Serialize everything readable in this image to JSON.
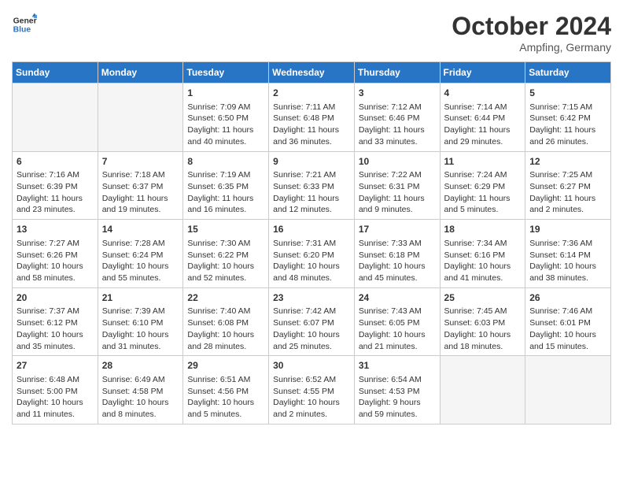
{
  "header": {
    "logo_line1": "General",
    "logo_line2": "Blue",
    "month": "October 2024",
    "location": "Ampfing, Germany"
  },
  "days_of_week": [
    "Sunday",
    "Monday",
    "Tuesday",
    "Wednesday",
    "Thursday",
    "Friday",
    "Saturday"
  ],
  "weeks": [
    [
      {
        "day": "",
        "info": ""
      },
      {
        "day": "",
        "info": ""
      },
      {
        "day": "1",
        "info": "Sunrise: 7:09 AM\nSunset: 6:50 PM\nDaylight: 11 hours and 40 minutes."
      },
      {
        "day": "2",
        "info": "Sunrise: 7:11 AM\nSunset: 6:48 PM\nDaylight: 11 hours and 36 minutes."
      },
      {
        "day": "3",
        "info": "Sunrise: 7:12 AM\nSunset: 6:46 PM\nDaylight: 11 hours and 33 minutes."
      },
      {
        "day": "4",
        "info": "Sunrise: 7:14 AM\nSunset: 6:44 PM\nDaylight: 11 hours and 29 minutes."
      },
      {
        "day": "5",
        "info": "Sunrise: 7:15 AM\nSunset: 6:42 PM\nDaylight: 11 hours and 26 minutes."
      }
    ],
    [
      {
        "day": "6",
        "info": "Sunrise: 7:16 AM\nSunset: 6:39 PM\nDaylight: 11 hours and 23 minutes."
      },
      {
        "day": "7",
        "info": "Sunrise: 7:18 AM\nSunset: 6:37 PM\nDaylight: 11 hours and 19 minutes."
      },
      {
        "day": "8",
        "info": "Sunrise: 7:19 AM\nSunset: 6:35 PM\nDaylight: 11 hours and 16 minutes."
      },
      {
        "day": "9",
        "info": "Sunrise: 7:21 AM\nSunset: 6:33 PM\nDaylight: 11 hours and 12 minutes."
      },
      {
        "day": "10",
        "info": "Sunrise: 7:22 AM\nSunset: 6:31 PM\nDaylight: 11 hours and 9 minutes."
      },
      {
        "day": "11",
        "info": "Sunrise: 7:24 AM\nSunset: 6:29 PM\nDaylight: 11 hours and 5 minutes."
      },
      {
        "day": "12",
        "info": "Sunrise: 7:25 AM\nSunset: 6:27 PM\nDaylight: 11 hours and 2 minutes."
      }
    ],
    [
      {
        "day": "13",
        "info": "Sunrise: 7:27 AM\nSunset: 6:26 PM\nDaylight: 10 hours and 58 minutes."
      },
      {
        "day": "14",
        "info": "Sunrise: 7:28 AM\nSunset: 6:24 PM\nDaylight: 10 hours and 55 minutes."
      },
      {
        "day": "15",
        "info": "Sunrise: 7:30 AM\nSunset: 6:22 PM\nDaylight: 10 hours and 52 minutes."
      },
      {
        "day": "16",
        "info": "Sunrise: 7:31 AM\nSunset: 6:20 PM\nDaylight: 10 hours and 48 minutes."
      },
      {
        "day": "17",
        "info": "Sunrise: 7:33 AM\nSunset: 6:18 PM\nDaylight: 10 hours and 45 minutes."
      },
      {
        "day": "18",
        "info": "Sunrise: 7:34 AM\nSunset: 6:16 PM\nDaylight: 10 hours and 41 minutes."
      },
      {
        "day": "19",
        "info": "Sunrise: 7:36 AM\nSunset: 6:14 PM\nDaylight: 10 hours and 38 minutes."
      }
    ],
    [
      {
        "day": "20",
        "info": "Sunrise: 7:37 AM\nSunset: 6:12 PM\nDaylight: 10 hours and 35 minutes."
      },
      {
        "day": "21",
        "info": "Sunrise: 7:39 AM\nSunset: 6:10 PM\nDaylight: 10 hours and 31 minutes."
      },
      {
        "day": "22",
        "info": "Sunrise: 7:40 AM\nSunset: 6:08 PM\nDaylight: 10 hours and 28 minutes."
      },
      {
        "day": "23",
        "info": "Sunrise: 7:42 AM\nSunset: 6:07 PM\nDaylight: 10 hours and 25 minutes."
      },
      {
        "day": "24",
        "info": "Sunrise: 7:43 AM\nSunset: 6:05 PM\nDaylight: 10 hours and 21 minutes."
      },
      {
        "day": "25",
        "info": "Sunrise: 7:45 AM\nSunset: 6:03 PM\nDaylight: 10 hours and 18 minutes."
      },
      {
        "day": "26",
        "info": "Sunrise: 7:46 AM\nSunset: 6:01 PM\nDaylight: 10 hours and 15 minutes."
      }
    ],
    [
      {
        "day": "27",
        "info": "Sunrise: 6:48 AM\nSunset: 5:00 PM\nDaylight: 10 hours and 11 minutes."
      },
      {
        "day": "28",
        "info": "Sunrise: 6:49 AM\nSunset: 4:58 PM\nDaylight: 10 hours and 8 minutes."
      },
      {
        "day": "29",
        "info": "Sunrise: 6:51 AM\nSunset: 4:56 PM\nDaylight: 10 hours and 5 minutes."
      },
      {
        "day": "30",
        "info": "Sunrise: 6:52 AM\nSunset: 4:55 PM\nDaylight: 10 hours and 2 minutes."
      },
      {
        "day": "31",
        "info": "Sunrise: 6:54 AM\nSunset: 4:53 PM\nDaylight: 9 hours and 59 minutes."
      },
      {
        "day": "",
        "info": ""
      },
      {
        "day": "",
        "info": ""
      }
    ]
  ]
}
